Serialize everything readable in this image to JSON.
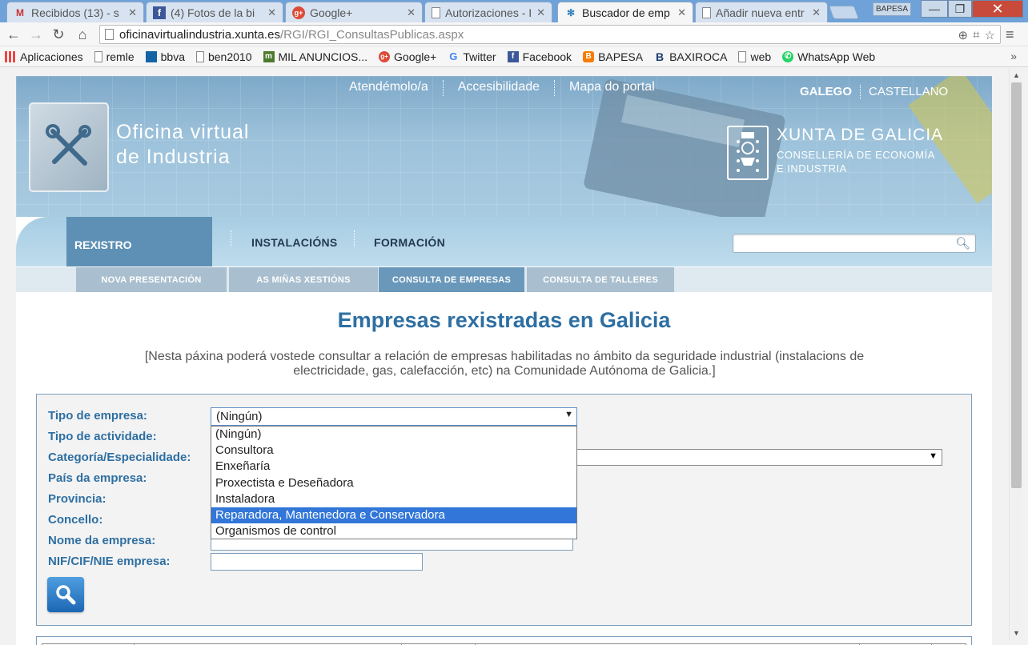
{
  "browser": {
    "tabs": [
      {
        "label": "Recibidos (13) - s",
        "icon": "gmail-icon",
        "active": false
      },
      {
        "label": "(4) Fotos de la bi",
        "icon": "facebook-icon",
        "active": false
      },
      {
        "label": "Google+",
        "icon": "google-plus-icon",
        "active": false
      },
      {
        "label": "Autorizaciones - I",
        "icon": "page-icon",
        "active": false
      },
      {
        "label": "Buscador de emp",
        "icon": "site-icon",
        "active": true
      },
      {
        "label": "Añadir nueva entr",
        "icon": "page-icon",
        "active": false
      }
    ],
    "profile_label": "BAPESA",
    "url_host": "oficinavirtualindustria.xunta.es",
    "url_path": "/RGI/RGI_ConsultasPublicas.aspx",
    "bookmarks": [
      {
        "label": "Aplicaciones",
        "icon": "apps-icon"
      },
      {
        "label": "remle",
        "icon": "page-icon"
      },
      {
        "label": "bbva",
        "icon": "bbva-icon"
      },
      {
        "label": "ben2010",
        "icon": "page-icon"
      },
      {
        "label": "MIL ANUNCIOS...",
        "icon": "milanuncios-icon"
      },
      {
        "label": "Google+",
        "icon": "google-plus-icon"
      },
      {
        "label": "Twitter",
        "icon": "google-icon"
      },
      {
        "label": "Facebook",
        "icon": "facebook-icon"
      },
      {
        "label": "BAPESA",
        "icon": "blogger-icon"
      },
      {
        "label": "BAXIROCA",
        "icon": "b-icon"
      },
      {
        "label": "web",
        "icon": "page-icon"
      },
      {
        "label": "WhatsApp Web",
        "icon": "whatsapp-icon"
      }
    ],
    "bookmarks_more": "»"
  },
  "header": {
    "site_title_line1": "Oficina virtual",
    "site_title_line2": "de Industria",
    "top_links": [
      "Atendémolo/a",
      "Accesibilidade",
      "Mapa do portal"
    ],
    "lang_active": "GALEGO",
    "lang_other": "CASTELLANO",
    "xunta_title": "XUNTA DE GALICIA",
    "xunta_sub1": "CONSELLERÍA DE ECONOMÍA",
    "xunta_sub2": "E INDUSTRIA"
  },
  "nav": {
    "main": [
      "REXISTRO",
      "INSTALACIÓNS",
      "FORMACIÓN"
    ],
    "sub": [
      "NOVA PRESENTACIÓN",
      "AS MIÑAS XESTIÓNS",
      "CONSULTA DE EMPRESAS",
      "CONSULTA DE TALLERES"
    ],
    "search_value": ""
  },
  "page": {
    "title": "Empresas rexistradas en Galicia",
    "description": "[Nesta páxina poderá vostede consultar a relación de empresas habilitadas no ámbito da seguridade industrial (instalacions de electricidade, gas, calefacción, etc) na Comunidade Autónoma de Galicia.]"
  },
  "form": {
    "labels": [
      "Tipo de empresa:",
      "Tipo de actividade:",
      "Categoría/Especialidade:",
      "País da empresa:",
      "Provincia:",
      "Concello:",
      "Nome da empresa:",
      "NIF/CIF/NIE empresa:"
    ],
    "tipo_empresa_value": "(Ningún)",
    "tipo_empresa_options": [
      "(Ningún)",
      "Consultora",
      "Enxeñaría",
      "Proxectista e Deseñadora",
      "Instaladora",
      "Reparadora, Mantenedora e Conservadora",
      "Organismos de control"
    ],
    "highlighted_option": "Reparadora, Mantenedora e Conservadora",
    "nome_value": "",
    "nif_value": ""
  },
  "colors": {
    "accent": "#2e6fa2",
    "highlight": "#3176d8"
  }
}
